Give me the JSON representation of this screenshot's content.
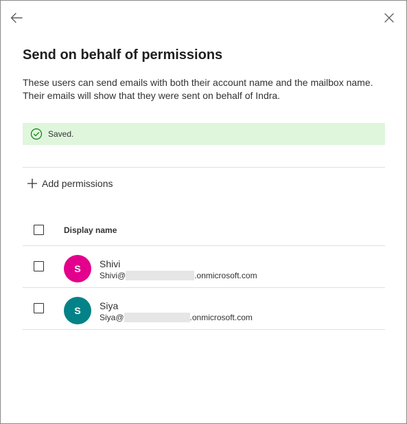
{
  "panel": {
    "back_icon": "back-arrow-icon",
    "close_icon": "close-icon",
    "title": "Send on behalf of permissions",
    "description": "These users can send emails with both their account name and the mailbox name. Their emails will show that they were sent on behalf of Indra."
  },
  "status": {
    "icon": "check-circle-icon",
    "text": "Saved.",
    "background": "#dff6dd"
  },
  "toolbar": {
    "add_icon": "plus-icon",
    "add_label": "Add permissions"
  },
  "table": {
    "columns": [
      "Display name"
    ],
    "rows": [
      {
        "initial": "S",
        "name": "Shivi",
        "email_prefix": "Shivi@",
        "email_suffix": ".onmicrosoft.com",
        "avatar_color": "#e3008c"
      },
      {
        "initial": "S",
        "name": "Siya",
        "email_prefix": "Siya@",
        "email_suffix": ".onmicrosoft.com",
        "avatar_color": "#038387"
      }
    ]
  }
}
